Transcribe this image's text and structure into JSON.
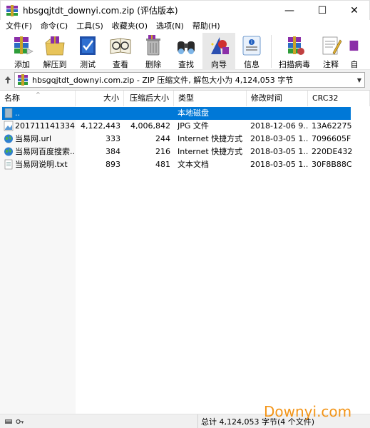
{
  "window": {
    "title": "hbsgqjtdt_downyi.com.zip (评估版本)",
    "controls": {
      "minimize": "—",
      "maximize": "☐",
      "close": "✕"
    }
  },
  "menu": [
    {
      "label": "文件(F)"
    },
    {
      "label": "命令(C)"
    },
    {
      "label": "工具(S)"
    },
    {
      "label": "收藏夹(O)"
    },
    {
      "label": "选项(N)"
    },
    {
      "label": "帮助(H)"
    }
  ],
  "toolbar": [
    {
      "label": "添加",
      "icon": "add-archive-icon"
    },
    {
      "label": "解压到",
      "icon": "extract-to-icon"
    },
    {
      "label": "测试",
      "icon": "test-icon"
    },
    {
      "label": "查看",
      "icon": "view-icon"
    },
    {
      "label": "删除",
      "icon": "delete-icon"
    },
    {
      "label": "查找",
      "icon": "find-icon"
    },
    {
      "label": "向导",
      "icon": "wizard-icon"
    },
    {
      "label": "信息",
      "icon": "info-icon"
    },
    {
      "label": "扫描病毒",
      "icon": "virus-scan-icon"
    },
    {
      "label": "注释",
      "icon": "comment-icon"
    },
    {
      "label": "自",
      "icon": "sfx-icon"
    }
  ],
  "pathbar": {
    "text": "hbsgqjtdt_downyi.com.zip - ZIP 压缩文件, 解包大小为 4,124,053 字节"
  },
  "columns": [
    {
      "label": "名称"
    },
    {
      "label": "大小"
    },
    {
      "label": "压缩后大小"
    },
    {
      "label": "类型"
    },
    {
      "label": "修改时间"
    },
    {
      "label": "CRC32"
    }
  ],
  "rows": [
    {
      "name": "..",
      "size": "",
      "packed": "",
      "type": "本地磁盘",
      "modified": "",
      "crc": "",
      "icon": "folder-up-icon",
      "selected": true
    },
    {
      "name": "201711141334...",
      "size": "4,122,443",
      "packed": "4,006,842",
      "type": "JPG 文件",
      "modified": "2018-12-06 9...",
      "crc": "13A62275",
      "icon": "image-file-icon",
      "selected": false
    },
    {
      "name": "当易网.url",
      "size": "333",
      "packed": "244",
      "type": "Internet 快捷方式",
      "modified": "2018-03-05 1...",
      "crc": "7096605F",
      "icon": "globe-icon",
      "selected": false
    },
    {
      "name": "当易网百度搜索....",
      "size": "384",
      "packed": "216",
      "type": "Internet 快捷方式",
      "modified": "2018-03-05 1...",
      "crc": "220DE432",
      "icon": "globe-icon",
      "selected": false
    },
    {
      "name": "当易网说明.txt",
      "size": "893",
      "packed": "481",
      "type": "文本文档",
      "modified": "2018-03-05 1...",
      "crc": "30F8B88C",
      "icon": "text-file-icon",
      "selected": false
    }
  ],
  "status": {
    "text": "总计 4,124,053 字节(4 个文件)"
  },
  "watermark": "Downyi.com",
  "colors": {
    "selection": "#0078d7",
    "watermark": "#f28a00"
  }
}
